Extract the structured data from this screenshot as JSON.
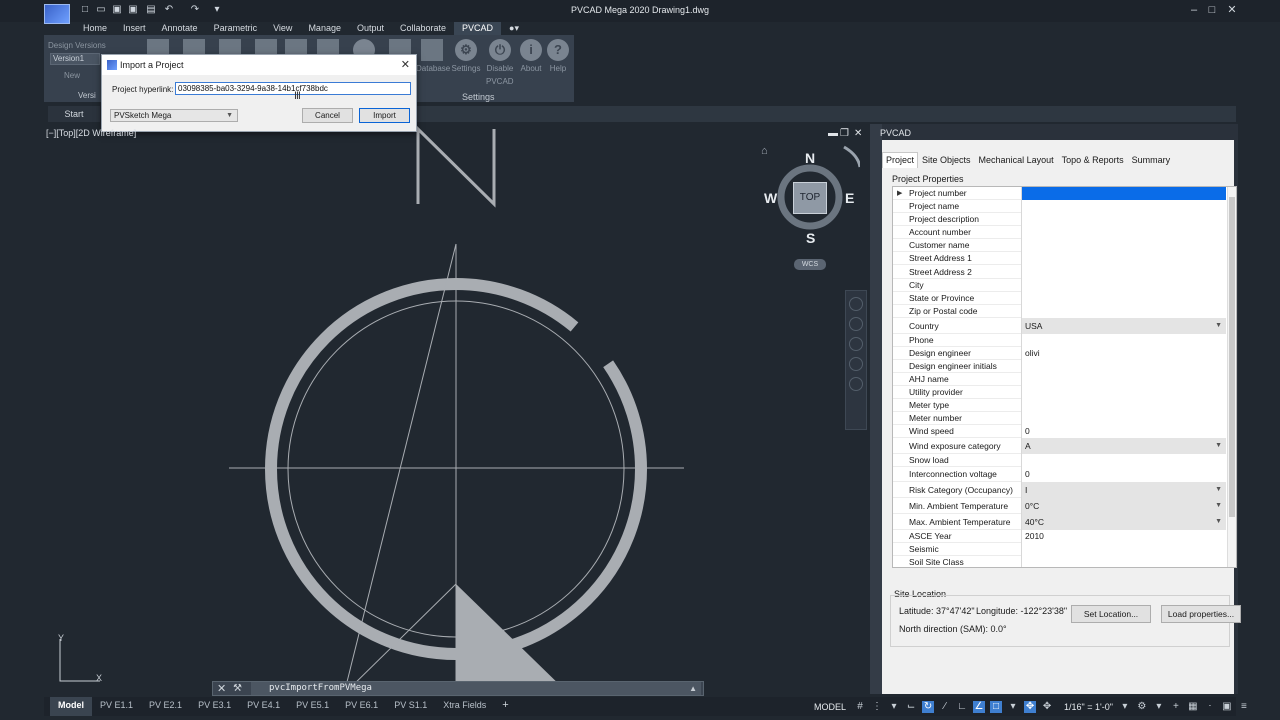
{
  "window": {
    "title": "PVCAD Mega 2020   Drawing1.dwg"
  },
  "ribbon": {
    "tabs": [
      "Home",
      "Insert",
      "Annotate",
      "Parametric",
      "View",
      "Manage",
      "Output",
      "Collaborate",
      "PVCAD"
    ],
    "active_tab": "PVCAD",
    "design_versions_label": "Design Versions",
    "version_value": "Version1",
    "new_label": "New",
    "version_caption": "Versi",
    "buttons": [
      "Database",
      "Settings",
      "Disable",
      "About",
      "Help"
    ],
    "pvcad_sub_label": "PVCAD",
    "settings_caption": "Settings"
  },
  "file_tabs": {
    "start": "Start"
  },
  "viewport": {
    "label": "[−][Top][2D Wireframe]",
    "compass": {
      "n": "N",
      "s": "S",
      "e": "E",
      "w": "W",
      "top": "TOP",
      "wcs": "WCS"
    },
    "ucs": {
      "y": "Y",
      "x": "X"
    }
  },
  "command_line": {
    "text": "pvcImportFromPVMega"
  },
  "status_bar": {
    "layout_tabs": [
      "Model",
      "PV E1.1",
      "PV E2.1",
      "PV E3.1",
      "PV E4.1",
      "PV E5.1",
      "PV E6.1",
      "PV S1.1",
      "Xtra Fields"
    ],
    "active_layout": "Model",
    "model_label": "MODEL",
    "scale": "1/16\" = 1'-0\""
  },
  "palette": {
    "title": "PVCAD",
    "tabs": [
      "Project",
      "Site Objects",
      "Mechanical Layout",
      "Topo & Reports",
      "Summary"
    ],
    "active_tab": "Project",
    "group_label": "Project Properties",
    "properties": [
      {
        "name": "Project number",
        "value": "",
        "type": "text",
        "selected": true
      },
      {
        "name": "Project name",
        "value": "",
        "type": "text"
      },
      {
        "name": "Project description",
        "value": "",
        "type": "text"
      },
      {
        "name": "Account number",
        "value": "",
        "type": "text"
      },
      {
        "name": "Customer name",
        "value": "",
        "type": "text"
      },
      {
        "name": "Street Address 1",
        "value": "",
        "type": "text"
      },
      {
        "name": "Street Address 2",
        "value": "",
        "type": "text"
      },
      {
        "name": "City",
        "value": "",
        "type": "text"
      },
      {
        "name": "State or Province",
        "value": "",
        "type": "text"
      },
      {
        "name": "Zip or Postal code",
        "value": "",
        "type": "text"
      },
      {
        "name": "Country",
        "value": "USA",
        "type": "combo"
      },
      {
        "name": "Phone",
        "value": "",
        "type": "text"
      },
      {
        "name": "Design engineer",
        "value": "olivi",
        "type": "text"
      },
      {
        "name": "Design engineer initials",
        "value": "",
        "type": "text"
      },
      {
        "name": "AHJ name",
        "value": "",
        "type": "text"
      },
      {
        "name": "Utility provider",
        "value": "",
        "type": "text"
      },
      {
        "name": "Meter type",
        "value": "",
        "type": "text"
      },
      {
        "name": "Meter number",
        "value": "",
        "type": "text"
      },
      {
        "name": "Wind speed",
        "value": "0",
        "type": "text"
      },
      {
        "name": "Wind exposure category",
        "value": "A",
        "type": "combo"
      },
      {
        "name": "Snow load",
        "value": "",
        "type": "text"
      },
      {
        "name": "Interconnection voltage",
        "value": "0",
        "type": "text"
      },
      {
        "name": "Risk Category (Occupancy)",
        "value": "I",
        "type": "combo"
      },
      {
        "name": "Min. Ambient Temperature",
        "value": "0°C",
        "type": "combo"
      },
      {
        "name": "Max. Ambient Temperature",
        "value": "40°C",
        "type": "combo"
      },
      {
        "name": "ASCE Year",
        "value": "2010",
        "type": "text"
      },
      {
        "name": "Seismic",
        "value": "",
        "type": "text"
      },
      {
        "name": "Soil Site Class",
        "value": "",
        "type": "text"
      }
    ],
    "site_location": {
      "label": "Site Location",
      "latitude": "Latitude: 37°47'42\"",
      "longitude": "Longitude: -122°23'38\"",
      "north_direction": "North direction (SAM):  0.0°",
      "set_location_button": "Set Location...",
      "load_properties_button": "Load properties..."
    }
  },
  "dialog": {
    "title": "Import a Project",
    "link_label": "Project hyperlink:",
    "link_value": "03098385-ba03-3294-9a38-14b1cf738bdc",
    "source_value": "PVSketch Mega",
    "cancel_label": "Cancel",
    "import_label": "Import"
  },
  "colors": {
    "background": "#212830",
    "accent": "#0a6ce8",
    "drawing": "#a9adb2"
  }
}
